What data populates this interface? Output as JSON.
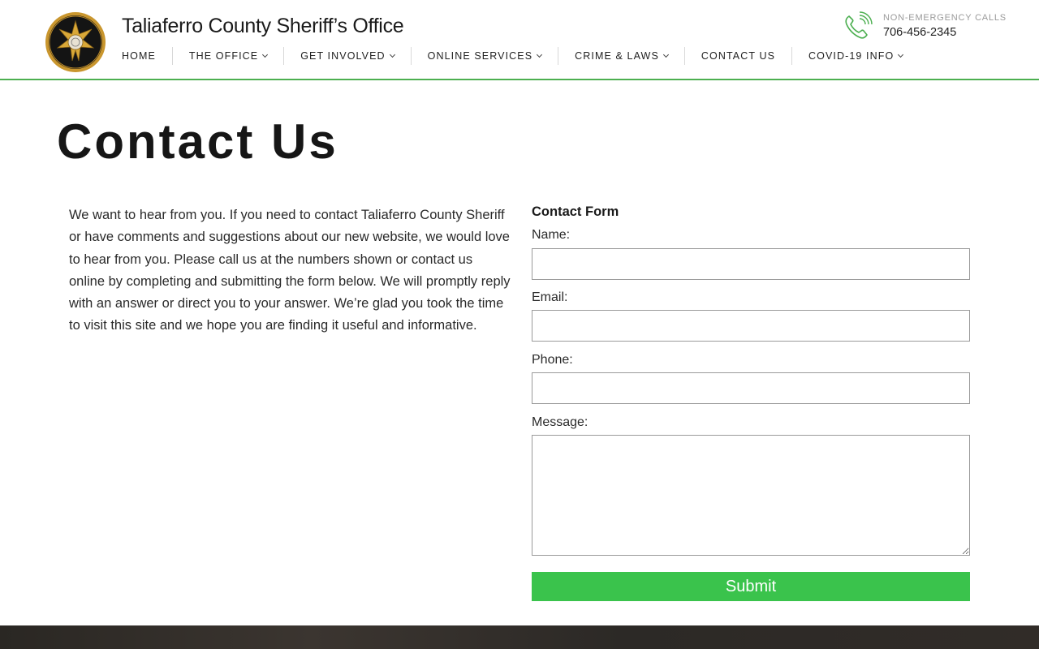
{
  "header": {
    "site_title": "Taliaferro County Sheriff’s Office",
    "seal_icon": "sheriff-star-seal-icon",
    "nav": [
      {
        "label": "HOME",
        "dropdown": false
      },
      {
        "label": "THE OFFICE",
        "dropdown": true
      },
      {
        "label": "GET INVOLVED",
        "dropdown": true
      },
      {
        "label": "ONLINE SERVICES",
        "dropdown": true
      },
      {
        "label": "CRIME & LAWS",
        "dropdown": true
      },
      {
        "label": "CONTACT US",
        "dropdown": false
      },
      {
        "label": "COVID-19 INFO",
        "dropdown": true
      }
    ],
    "phone": {
      "icon": "phone-icon",
      "label": "NON-EMERGENCY CALLS",
      "number": "706-456-2345"
    },
    "accent_color": "#4caf50"
  },
  "main": {
    "title": "Contact Us",
    "intro": "We want to hear from you. If you need to contact Taliaferro County Sheriff or have comments and suggestions about our new website, we would love to hear from you. Please call us at the numbers shown or contact us online by completing and submitting the form below. We will promptly reply with an answer or direct you to your answer. We’re glad you took the time to visit this site and we hope you are finding it useful and informative.",
    "form": {
      "title": "Contact Form",
      "name_label": "Name:",
      "name_value": "",
      "email_label": "Email:",
      "email_value": "",
      "phone_label": "Phone:",
      "phone_value": "",
      "message_label": "Message:",
      "message_value": "",
      "submit_label": "Submit",
      "submit_color": "#3ac34c"
    }
  }
}
